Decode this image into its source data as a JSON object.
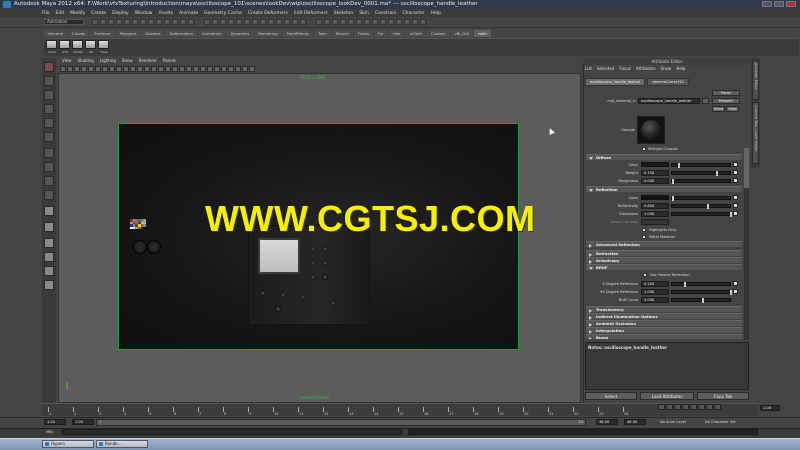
{
  "window": {
    "title": "Autodesk Maya 2012 x64: F:\\Work\\vfxTexturing\\Introduction\\maya\\oscilloscope_101\\scenes\\lookDev\\wip\\oscilloscope_lookDev_0001.ma* --- oscilloscope_handle_leather"
  },
  "menubar": [
    "File",
    "Edit",
    "Modify",
    "Create",
    "Display",
    "Window",
    "Assets",
    "Animate",
    "Geometry Cache",
    "Create Deformers",
    "Edit Deformers",
    "Skeleton",
    "Skin",
    "Constrain",
    "Character",
    "Help"
  ],
  "status_line": {
    "mode": "Animation"
  },
  "shelf": {
    "tabs": [
      "General",
      "Curves",
      "Surfaces",
      "Polygons",
      "Subdivs",
      "Deformation",
      "Animation",
      "Dynamics",
      "Rendering",
      "PaintEffects",
      "Toon",
      "Muscle",
      "Fluids",
      "Fur",
      "Hair",
      "nCloth",
      "Custom",
      "vBi_GUI",
      "mhh"
    ],
    "active_tab": "mhh",
    "buttons": [
      "Dual",
      "GTX",
      "Model",
      "SE",
      "Flare"
    ]
  },
  "viewport": {
    "panel_menu": [
      "View",
      "Shading",
      "Lighting",
      "Show",
      "Renderer",
      "Panels"
    ],
    "resolution_label": "1920 x 1080",
    "camera_label": "renderCamera"
  },
  "attribute_editor": {
    "title": "Attribute Editor",
    "menu": [
      "List",
      "Selected",
      "Focus",
      "Attributes",
      "Show",
      "Help"
    ],
    "tabs": [
      "oscilloscope_handle_leather",
      "gammaCorrect10"
    ],
    "active_tab": "oscilloscope_handle_leather",
    "material_label": "mia_material_x:",
    "material_name": "oscilloscope_handle_leather",
    "focus_button": "Focus",
    "presets_button": "Presets*",
    "show_button": "Show",
    "hide_button": "Hide",
    "sample_label": "Sample",
    "multiple_outputs_label": "Multiple Outputs",
    "diffuse": {
      "header": "Diffuse",
      "color_label": "Color",
      "weight_label": "Weight",
      "weight_value": "0.750",
      "roughness_label": "Roughness",
      "roughness_value": "0.000"
    },
    "reflection": {
      "header": "Reflection",
      "color_label": "Color",
      "reflectivity_label": "Reflectivity",
      "reflectivity_value": "0.600",
      "glossiness_label": "Glossiness",
      "glossiness_value": "1.000",
      "glossy_samples_label": "Glossy Samples",
      "highlights_only_label": "Highlights Only",
      "metal_material_label": "Metal Material"
    },
    "collapsed_sections": [
      "Advanced Reflection",
      "Refraction",
      "Anisotropy"
    ],
    "brdf": {
      "header": "BRDF",
      "fresnel_label": "Use Fresnel Reflection",
      "deg0_label": "0 Degree Reflection",
      "deg0_value": "0.200",
      "deg90_label": "90 Degree Reflection",
      "deg90_value": "1.000",
      "curve_label": "Brdf Curve",
      "curve_value": "5.000"
    },
    "more_sections": [
      "Translucency",
      "Indirect Illumination Options",
      "Ambient Occlusion",
      "Interpolation",
      "Bump"
    ],
    "notes_label": "Notes: oscilloscope_handle_leather",
    "select_button": "Select",
    "load_button": "Load Attributes",
    "copy_button": "Copy Tab"
  },
  "side_tabs": [
    "Attribute Editor",
    "Channel Box / Layer Editor"
  ],
  "watermark": "WWW.CGTSJ.COM",
  "timeline": {
    "ticks": [
      "1",
      "2",
      "3",
      "4",
      "5",
      "6",
      "7",
      "8",
      "9",
      "10",
      "11",
      "12",
      "13",
      "14",
      "15",
      "16",
      "17",
      "18",
      "19",
      "20",
      "21",
      "22",
      "23",
      "24"
    ],
    "current_frame": "1.00"
  },
  "range": {
    "start": "1.00",
    "inner_start": "1.00",
    "marker": "1",
    "marker_end": "24",
    "end": "36.00",
    "end2": "48.00",
    "anim_layer": "No Anim Layer",
    "char_set": "No Character Set"
  },
  "command_line": {
    "label": "MEL"
  },
  "taskbar": {
    "items": [
      "Hypers",
      "Rende..."
    ]
  },
  "colors": {
    "resolution_gate": "#2a9a3a",
    "watermark": "#f4f000",
    "title_bar": "#2e3a4a"
  }
}
